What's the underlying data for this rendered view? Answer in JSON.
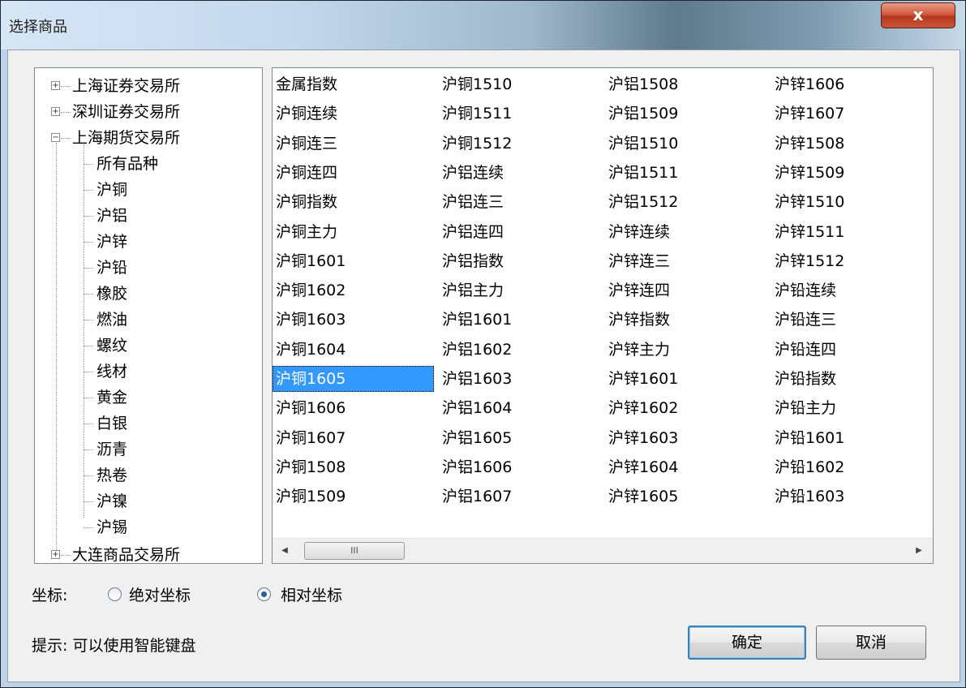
{
  "window": {
    "title": "选择商品",
    "close_label": "x"
  },
  "tree": {
    "exchanges": [
      "上海证券交易所",
      "深圳证券交易所",
      "上海期货交易所"
    ],
    "children": [
      "所有品种",
      "沪铜",
      "沪铝",
      "沪锌",
      "沪铅",
      "橡胶",
      "燃油",
      "螺纹",
      "线材",
      "黄金",
      "白银",
      "沥青",
      "热卷",
      "沪镍",
      "沪锡"
    ],
    "last_exchange": "大连商品交易所",
    "expander_plus": "+",
    "expander_minus": "−"
  },
  "list": {
    "columns": [
      [
        "金属指数",
        "沪铜连续",
        "沪铜连三",
        "沪铜连四",
        "沪铜指数",
        "沪铜主力",
        "沪铜1601",
        "沪铜1602",
        "沪铜1603",
        "沪铜1604",
        "沪铜1605",
        "沪铜1606",
        "沪铜1607",
        "沪铜1508",
        "沪铜1509"
      ],
      [
        "沪铜1510",
        "沪铜1511",
        "沪铜1512",
        "沪铝连续",
        "沪铝连三",
        "沪铝连四",
        "沪铝指数",
        "沪铝主力",
        "沪铝1601",
        "沪铝1602",
        "沪铝1603",
        "沪铝1604",
        "沪铝1605",
        "沪铝1606",
        "沪铝1607"
      ],
      [
        "沪铝1508",
        "沪铝1509",
        "沪铝1510",
        "沪铝1511",
        "沪铝1512",
        "沪锌连续",
        "沪锌连三",
        "沪锌连四",
        "沪锌指数",
        "沪锌主力",
        "沪锌1601",
        "沪锌1602",
        "沪锌1603",
        "沪锌1604",
        "沪锌1605"
      ],
      [
        "沪锌1606",
        "沪锌1607",
        "沪锌1508",
        "沪锌1509",
        "沪锌1510",
        "沪锌1511",
        "沪锌1512",
        "沪铅连续",
        "沪铅连三",
        "沪铅连四",
        "沪铅指数",
        "沪铅主力",
        "沪铅1601",
        "沪铅1602",
        "沪铅1603"
      ]
    ],
    "selected": "沪铜1605",
    "hscroll_grip": "III"
  },
  "coords": {
    "label": "坐标:",
    "absolute": "绝对坐标",
    "relative": "相对坐标",
    "selected": "相对坐标"
  },
  "hint": "提示: 可以使用智能键盘",
  "buttons": {
    "ok": "确定",
    "cancel": "取消"
  }
}
